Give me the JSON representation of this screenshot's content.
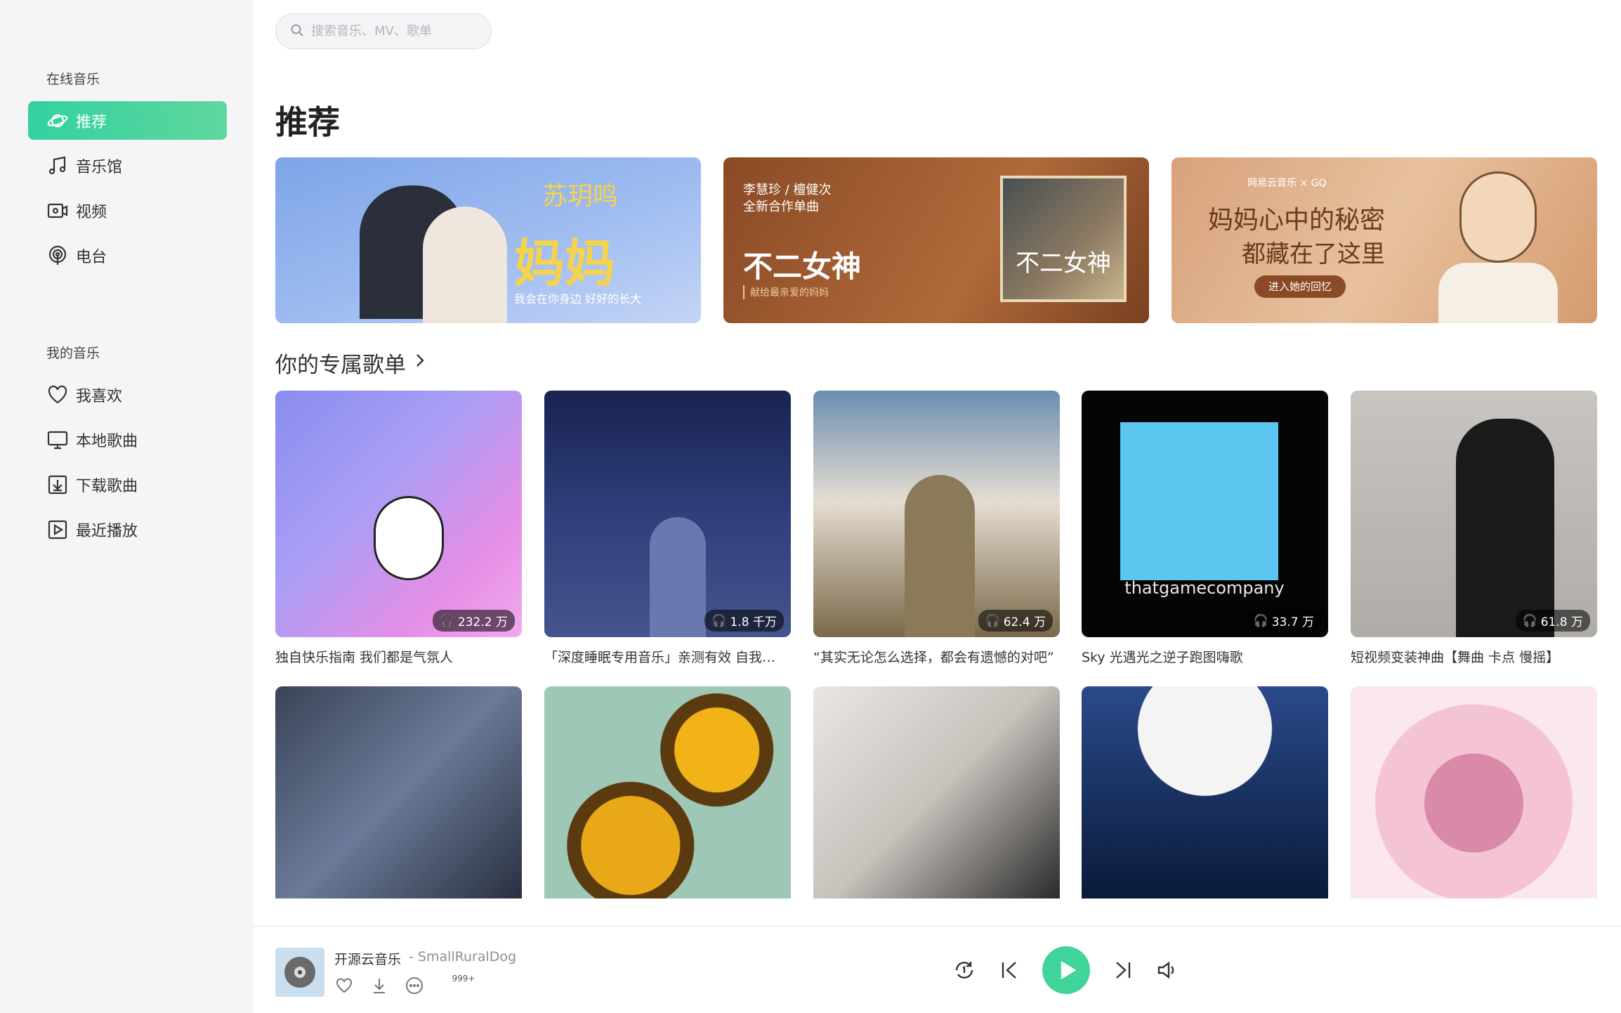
{
  "sidebar": {
    "online_section": "在线音乐",
    "online_items": [
      {
        "label": "推荐",
        "icon": "planet-icon",
        "active": true
      },
      {
        "label": "音乐馆",
        "icon": "music-note-icon"
      },
      {
        "label": "视频",
        "icon": "video-icon"
      },
      {
        "label": "电台",
        "icon": "radio-icon"
      }
    ],
    "my_section": "我的音乐",
    "my_items": [
      {
        "label": "我喜欢",
        "icon": "heart-icon"
      },
      {
        "label": "本地歌曲",
        "icon": "monitor-icon"
      },
      {
        "label": "下载歌曲",
        "icon": "download-icon"
      },
      {
        "label": "最近播放",
        "icon": "play-history-icon"
      }
    ]
  },
  "search": {
    "placeholder": "搜索音乐、MV、歌单"
  },
  "page_title": "推荐",
  "banners": [
    {
      "title": "苏玥鸣",
      "big": "妈妈",
      "subtitle": "我会在你身边 好好的长大"
    },
    {
      "top": "李慧珍 / 檀健次",
      "top2": "全新合作单曲",
      "title": "不二女神",
      "subtitle": "献给最亲爱的妈妈",
      "cover_text": "不二女神"
    },
    {
      "brand": "网易云音乐 × GQ",
      "title1": "妈妈心中的秘密",
      "title2": "都藏在了这里",
      "button": "进入她的回忆"
    }
  ],
  "section_title": "你的专属歌单",
  "playlists": [
    {
      "title": "独自快乐指南 我们都是气氛人",
      "plays": "232.2 万"
    },
    {
      "title": "「深度睡眠专用音乐」亲测有效 自我…",
      "plays": "1.8 千万"
    },
    {
      "title": "“其实无论怎么选择，都会有遗憾的对吧”",
      "plays": "62.4 万"
    },
    {
      "title": "Sky 光遇光之逆子跑图嗨歌",
      "plays": "33.7 万",
      "cover_text": "thatgamecompany"
    },
    {
      "title": "短视频变装神曲【舞曲 卡点 慢摇】",
      "plays": "61.8 万"
    }
  ],
  "player": {
    "song": "开源云音乐",
    "artist": "- SmallRuralDog",
    "comment_count": "999+"
  },
  "colors": {
    "accent": "#3fd49a",
    "sidebar_bg": "#f5f5f7"
  }
}
